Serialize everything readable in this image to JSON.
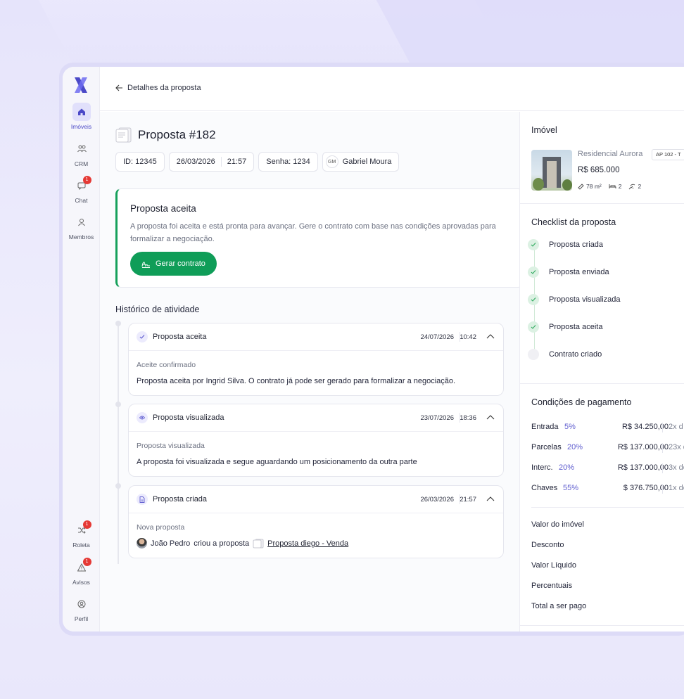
{
  "nav": {
    "items": [
      {
        "label": "Imóveis",
        "icon": "home-icon"
      },
      {
        "label": "CRM",
        "icon": "users-icon"
      },
      {
        "label": "Chat",
        "icon": "chat-icon",
        "badge": "1"
      },
      {
        "label": "Membros",
        "icon": "member-icon"
      }
    ],
    "bottom": [
      {
        "label": "Roleta",
        "icon": "shuffle-icon",
        "badge": "1"
      },
      {
        "label": "Avisos",
        "icon": "alert-icon",
        "badge": "1"
      },
      {
        "label": "Perfil",
        "icon": "profile-icon"
      }
    ]
  },
  "header": {
    "back_label": "Detalhes da proposta"
  },
  "proposal": {
    "title": "Proposta #182",
    "id": "ID: 12345",
    "date": "26/03/2026",
    "time": "21:57",
    "password": "Senha: 1234",
    "user_initials": "GM",
    "user_name": "Gabriel Moura"
  },
  "accept_card": {
    "title": "Proposta aceita",
    "description": "A proposta foi aceita e está pronta para avançar. Gere o contrato com base nas condições aprovadas para formalizar a negociação.",
    "button": "Gerar contrato",
    "accent": "#0f9d58"
  },
  "history": {
    "title": "Histórico de atividade",
    "items": [
      {
        "title": "Proposta aceita",
        "date": "24/07/2026",
        "time": "10:42",
        "subtitle": "Aceite confirmado",
        "text": "Proposta aceita por Ingrid Silva. O contrato já pode ser gerado para formalizar a negociação."
      },
      {
        "title": "Proposta visualizada",
        "date": "23/07/2026",
        "time": "18:36",
        "subtitle": "Proposta visualizada",
        "text": "A proposta foi visualizada e segue aguardando um posicionamento da outra parte"
      },
      {
        "title": "Proposta criada",
        "date": "26/03/2026",
        "time": "21:57",
        "subtitle": "Nova proposta",
        "author": "João Pedro",
        "action": "criou a proposta",
        "link": "Proposta diego - Venda"
      }
    ]
  },
  "property": {
    "section_title": "Imóvel",
    "name": "Residencial Aurora",
    "tag": "AP 102 - T",
    "price": "R$ 685.000",
    "area": "78 m²",
    "beds": "2",
    "baths": "2"
  },
  "checklist": {
    "title": "Checklist da proposta",
    "items": [
      {
        "label": "Proposta criada",
        "done": true
      },
      {
        "label": "Proposta enviada",
        "done": true
      },
      {
        "label": "Proposta visualizada",
        "done": true
      },
      {
        "label": "Proposta aceita",
        "done": true
      },
      {
        "label": "Contrato criado",
        "done": false
      }
    ]
  },
  "payment": {
    "title": "Condições de pagamento",
    "rows": [
      {
        "label": "Entrada",
        "pct": "5%",
        "value": "R$ 34.250,00",
        "inst": "2x d"
      },
      {
        "label": "Parcelas",
        "pct": "20%",
        "value": "R$ 137.000,00",
        "inst": "23x d"
      },
      {
        "label": "Interc.",
        "pct": "20%",
        "value": "R$ 137.000,00",
        "inst": "3x de"
      },
      {
        "label": "Chaves",
        "pct": "55%",
        "value": "$ 376.750,00",
        "inst": "1x de"
      }
    ],
    "summary": [
      "Valor do imóvel",
      "Desconto",
      "Valor Líquido",
      "Percentuais",
      "Total a ser pago"
    ]
  }
}
